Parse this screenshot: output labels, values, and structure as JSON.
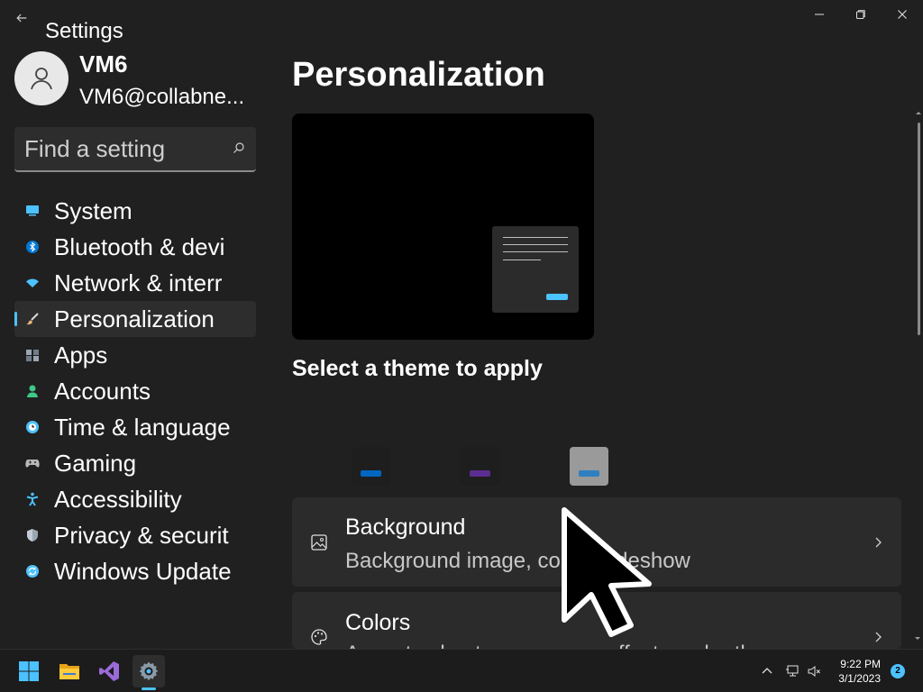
{
  "window": {
    "title": "Settings",
    "controls": [
      "minimize",
      "restore",
      "close"
    ]
  },
  "user": {
    "name": "VM6",
    "email": "VM6@collabne..."
  },
  "search": {
    "placeholder": "Find a setting",
    "icon": "search-icon"
  },
  "sidebar": {
    "items": [
      {
        "label": "System",
        "icon": "system-icon",
        "color": "#4cc2ff"
      },
      {
        "label": "Bluetooth & devi",
        "icon": "bluetooth-icon",
        "color": "#0078d4"
      },
      {
        "label": "Network & interr",
        "icon": "network-icon",
        "color": "#4cc2ff"
      },
      {
        "label": "Personalization",
        "icon": "brush-icon",
        "color": "#e8b37a",
        "selected": true
      },
      {
        "label": "Apps",
        "icon": "apps-icon",
        "color": "#9aa6b2"
      },
      {
        "label": "Accounts",
        "icon": "accounts-icon",
        "color": "#3ec98a"
      },
      {
        "label": "Time & language",
        "icon": "time-language-icon",
        "color": "#4cc2ff"
      },
      {
        "label": "Gaming",
        "icon": "gaming-icon",
        "color": "#b8b8b8"
      },
      {
        "label": "Accessibility",
        "icon": "accessibility-icon",
        "color": "#4cc2ff"
      },
      {
        "label": "Privacy & securit",
        "icon": "shield-icon",
        "color": "#9aa6b2"
      },
      {
        "label": "Windows Update",
        "icon": "windows-update-icon",
        "color": "#4cc2ff"
      }
    ]
  },
  "main": {
    "title": "Personalization",
    "theme_heading": "Select a theme to apply",
    "themes": [
      {
        "name": "theme-dark-blue",
        "bg": "#1e1e1e",
        "bar": "#0067c0"
      },
      {
        "name": "theme-dark-purple",
        "bg": "#1e1e1e",
        "bar": "#5c2d91"
      },
      {
        "name": "theme-light-gray",
        "bg": "#9a9a9a",
        "bar": "#2f7fc1"
      }
    ],
    "cards": [
      {
        "title": "Background",
        "subtitle": "Background image, color, slideshow",
        "icon": "image-icon"
      },
      {
        "title": "Colors",
        "subtitle": "Accent color, transparency effects, color theme",
        "icon": "palette-icon"
      }
    ]
  },
  "taskbar": {
    "apps": [
      "start-icon",
      "file-explorer-icon",
      "visual-studio-icon",
      "settings-icon"
    ],
    "active_app": "settings-icon",
    "time": "9:22 PM",
    "date": "3/1/2023",
    "notification_count": "2"
  },
  "colors": {
    "background": "#202020",
    "card": "#2b2b2b",
    "accent": "#4cc2ff"
  }
}
